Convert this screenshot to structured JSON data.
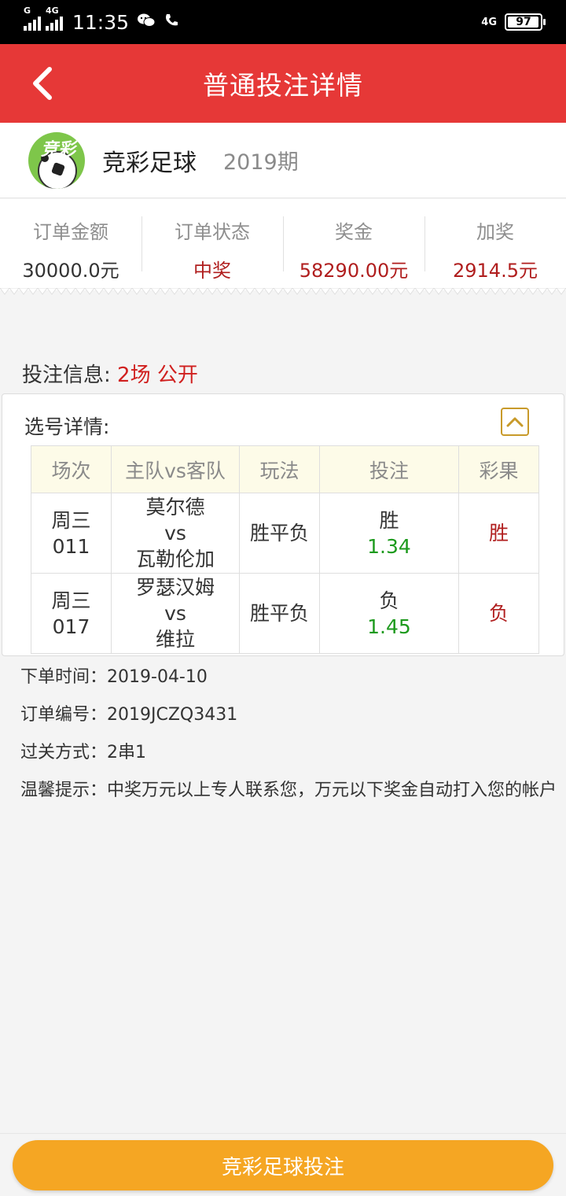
{
  "status_bar": {
    "signal1_tag": "G",
    "signal2_tag": "4G",
    "time": "11:35",
    "network": "4G",
    "battery": "97",
    "battery_level": 0.97
  },
  "header": {
    "title": "普通投注详情"
  },
  "lottery": {
    "logo_text": "竞彩",
    "name": "竞彩足球",
    "issue": "2019期"
  },
  "stats": [
    {
      "label": "订单金额",
      "value": "30000.0元"
    },
    {
      "label": "订单状态",
      "value": "中奖"
    },
    {
      "label": "奖金",
      "value": "58290.00元"
    },
    {
      "label": "加奖",
      "value": "2914.5元"
    }
  ],
  "bet_info": {
    "label": "投注信息:",
    "matches": "2场",
    "visibility": "公开"
  },
  "detail": {
    "title": "选号详情:",
    "headers": [
      "场次",
      "主队vs客队",
      "玩法",
      "投注",
      "彩果"
    ],
    "rows": [
      {
        "day": "周三",
        "num": "011",
        "home": "莫尔德",
        "vs": "vs",
        "away": "瓦勒伦加",
        "play": "胜平负",
        "pick": "胜",
        "odds": "1.34",
        "result": "胜"
      },
      {
        "day": "周三",
        "num": "017",
        "home": "罗瑟汉姆",
        "vs": "vs",
        "away": "维拉",
        "play": "胜平负",
        "pick": "负",
        "odds": "1.45",
        "result": "负"
      }
    ]
  },
  "order": {
    "time_label": "下单时间：",
    "time_value": "2019-04-10",
    "id_label": "订单编号：",
    "id_value": "2019JCZQ3431",
    "pass_label": "过关方式：",
    "pass_value": "2串1",
    "tip_label": "温馨提示：",
    "tip_value": "中奖万元以上专人联系您，万元以下奖金自动打入您的帐户"
  },
  "bottom": {
    "button_label": "竞彩足球投注"
  },
  "colors": {
    "header_red": "#e63837",
    "win_red": "#b01e1e",
    "odds_green": "#1d9a1d",
    "button_orange": "#f5a623"
  }
}
